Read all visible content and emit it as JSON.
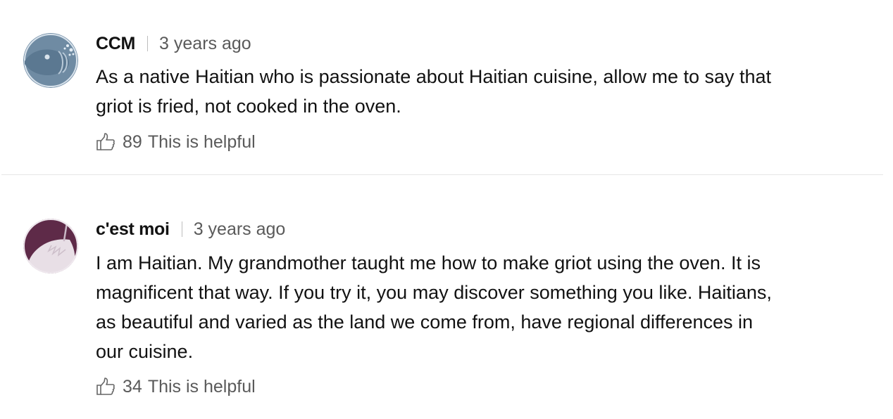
{
  "comments": [
    {
      "author": "CCM",
      "time": "3 years ago",
      "body": "As a native Haitian who is passionate about Haitian cuisine, allow me to say that\ngriot is fried, not cooked in the oven.",
      "helpful_count": "89",
      "helpful_label": "This is helpful",
      "avatar_icon": "fish-avatar-icon"
    },
    {
      "author": "c'est moi",
      "time": "3 years ago",
      "body": "I am Haitian. My grandmother taught me how to make griot using the oven. It is\nmagnificent that way. If you try it, you may discover something you like. Haitians,\nas beautiful and varied as the land we come from, have regional differences in\nour cuisine.",
      "helpful_count": "34",
      "helpful_label": "This is helpful",
      "avatar_icon": "narwhal-avatar-icon"
    }
  ],
  "colors": {
    "text": "#121212",
    "meta": "#5a5a5a",
    "divider": "#e6e6e6",
    "fish_avatar_bg": "#6f8ba3",
    "narwhal_avatar_bg": "#5e2a48"
  }
}
